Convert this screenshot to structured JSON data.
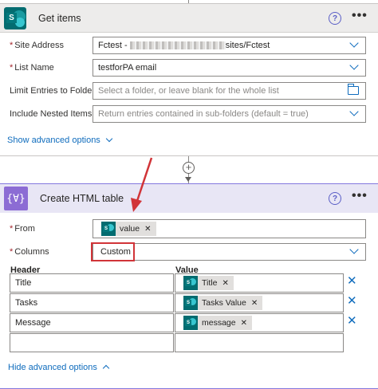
{
  "get_items": {
    "title": "Get items",
    "help_icon": "?",
    "more_icon": "•••",
    "logo_letter": "S",
    "fields": [
      {
        "label": "Site Address",
        "required": true,
        "value_prefix": "Fctest - ",
        "value_suffix": "sites/Fctest"
      },
      {
        "label": "List Name",
        "required": true,
        "value": "testforPA email"
      },
      {
        "label": "Limit Entries to Folder",
        "required": false,
        "placeholder": "Select a folder, or leave blank for the whole list"
      },
      {
        "label": "Include Nested Items",
        "required": false,
        "placeholder": "Return entries contained in sub-folders (default = true)"
      }
    ],
    "show_advanced": "Show advanced options"
  },
  "create_html_table": {
    "title": "Create HTML table",
    "logo_glyph": "{∀}",
    "help_icon": "?",
    "more_icon": "•••",
    "from_label": "From",
    "from_token": "value",
    "columns_label": "Columns",
    "columns_value": "Custom",
    "header_col": "Header",
    "value_col": "Value",
    "rows": [
      {
        "header": "Title",
        "value": "Title"
      },
      {
        "header": "Tasks",
        "value": "Tasks Value"
      },
      {
        "header": "Message",
        "value": "message"
      }
    ],
    "hide_advanced": "Hide advanced options"
  },
  "colors": {
    "sharepoint": "#036c70",
    "data_ops": "#8c6cd4",
    "accent": "#0f6cbd",
    "highlight": "#d13438"
  }
}
